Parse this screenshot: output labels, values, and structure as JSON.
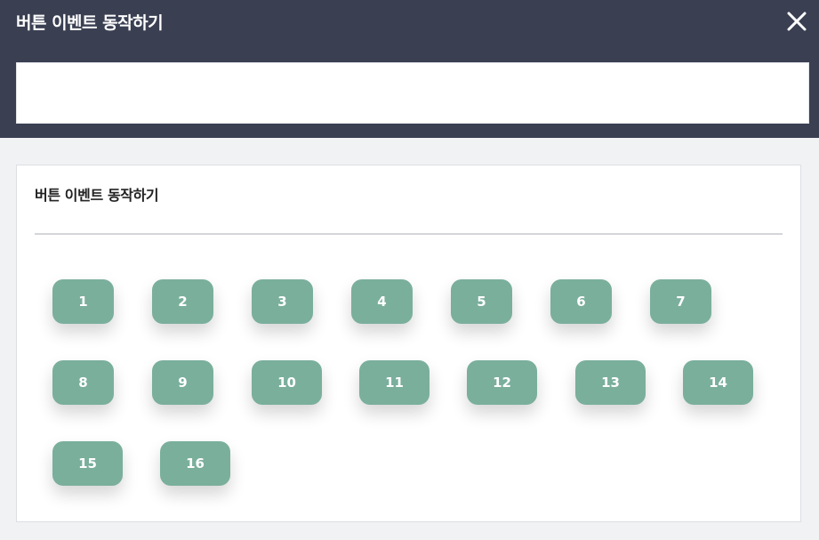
{
  "header": {
    "title": "버튼 이벤트 동작하기",
    "close_icon": "close-icon",
    "field_value": ""
  },
  "panel": {
    "title": "버튼 이벤트 동작하기",
    "buttons": [
      "1",
      "2",
      "3",
      "4",
      "5",
      "6",
      "7",
      "8",
      "9",
      "10",
      "11",
      "12",
      "13",
      "14",
      "15",
      "16"
    ]
  },
  "colors": {
    "header_bg": "#3a3f52",
    "button_bg": "#7aaf9c",
    "page_bg": "#f1f2f4"
  }
}
